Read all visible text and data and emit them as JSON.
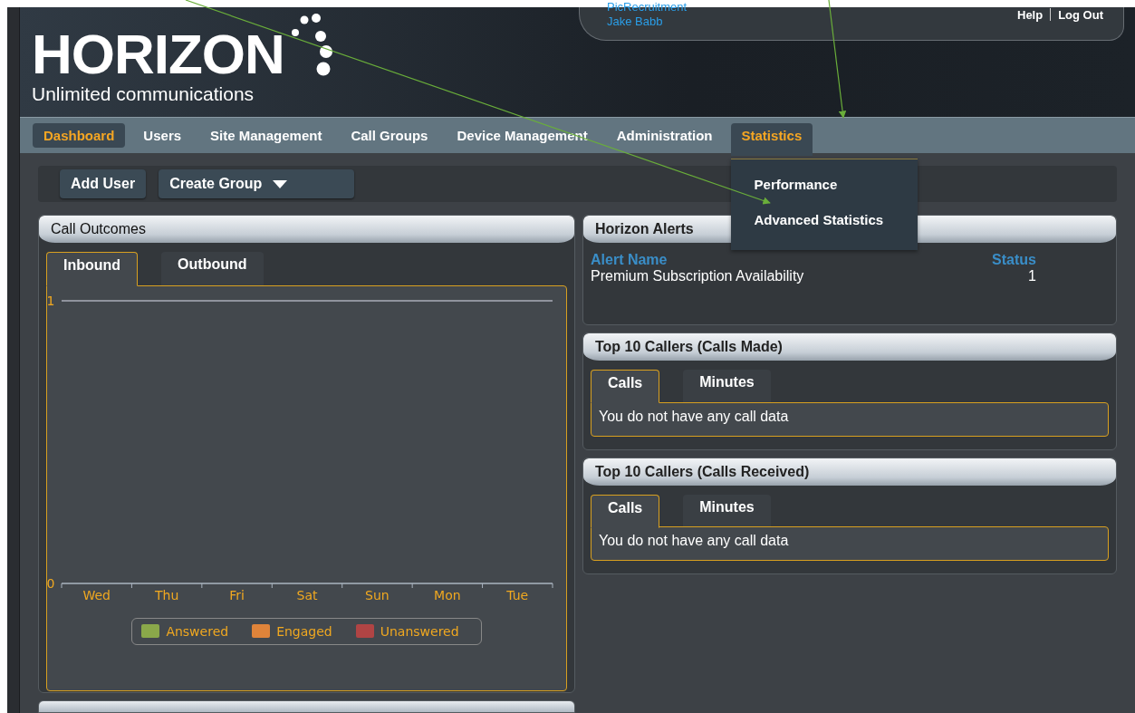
{
  "header": {
    "logo": "HORIZON",
    "tagline": "Unlimited communications",
    "account": [
      "PicRecruitment",
      "Jake Babb"
    ],
    "links": [
      "Help",
      "Log Out"
    ]
  },
  "nav": [
    {
      "label": "Dashboard",
      "selected": true
    },
    {
      "label": "Users",
      "selected": false
    },
    {
      "label": "Site Management",
      "selected": false
    },
    {
      "label": "Call Groups",
      "selected": false
    },
    {
      "label": "Device Management",
      "selected": false
    },
    {
      "label": "Administration",
      "selected": false
    },
    {
      "label": "Statistics",
      "open": true
    }
  ],
  "menu": [
    "Performance",
    "Advanced Statistics"
  ],
  "toolbar": [
    {
      "label": "Add User",
      "kind": "button"
    },
    {
      "label": "Create Group",
      "kind": "dropdown"
    }
  ],
  "call_outcomes": {
    "title": "Call Outcomes",
    "tabs": [
      {
        "label": "Inbound",
        "selected": true
      },
      {
        "label": "Outbound",
        "selected": false
      }
    ],
    "chart_data": {
      "type": "bar",
      "categories": [
        "Wed",
        "Thu",
        "Fri",
        "Sat",
        "Sun",
        "Mon",
        "Tue"
      ],
      "ylim": [
        0,
        1
      ],
      "yticks": [
        0,
        1
      ],
      "series": [
        {
          "name": "Answered",
          "color": "#8aa84a",
          "values": [
            null,
            null,
            null,
            null,
            null,
            null,
            null
          ]
        },
        {
          "name": "Engaged",
          "color": "#e0843a",
          "values": [
            null,
            null,
            null,
            null,
            null,
            null,
            null
          ]
        },
        {
          "name": "Unanswered",
          "color": "#b04444",
          "values": [
            null,
            null,
            null,
            null,
            null,
            null,
            null
          ]
        }
      ]
    }
  },
  "alerts": {
    "title": "Horizon Alerts",
    "columns": [
      "Alert Name",
      "Status"
    ],
    "rows": [
      [
        "Premium Subscription Availability",
        "1"
      ]
    ]
  },
  "callers": [
    {
      "title": "Top 10 Callers (Calls Made)",
      "tabs": [
        {
          "label": "Calls",
          "selected": true
        },
        {
          "label": "Minutes",
          "selected": false
        }
      ],
      "message": "You do not have any call data"
    },
    {
      "title": "Top 10 Callers (Calls Received)",
      "tabs": [
        {
          "label": "Calls",
          "selected": true
        },
        {
          "label": "Minutes",
          "selected": false
        }
      ],
      "message": "You do not have any call data"
    }
  ]
}
